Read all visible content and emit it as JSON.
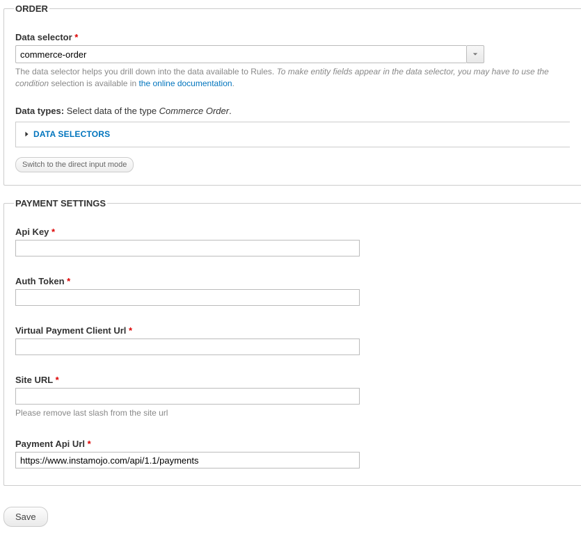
{
  "order_panel": {
    "legend": "ORDER",
    "data_selector_label": "Data selector",
    "data_selector_value": "commerce-order",
    "help_prefix": "The data selector helps you drill down into the data available to Rules. ",
    "help_italic": "To make entity fields appear in the data selector, you may have to use the condition",
    "help_suffix_prefix": " selection is available in ",
    "help_link_text": "the online documentation",
    "help_suffix_end": ".",
    "data_types_label": "Data types:",
    "data_types_text_prefix": " Select data of the type ",
    "data_types_em": "Commerce Order",
    "data_types_text_suffix": ".",
    "selectors_toggle": "DATA SELECTORS",
    "switch_mode_label": "Switch to the direct input mode"
  },
  "payment_panel": {
    "legend": "PAYMENT SETTINGS",
    "api_key_label": "Api Key",
    "api_key_value": "",
    "auth_token_label": "Auth Token",
    "auth_token_value": "",
    "vpc_label": "Virtual Payment Client Url",
    "vpc_value": "",
    "site_url_label": "Site URL",
    "site_url_value": "",
    "site_url_help": "Please remove last slash from the site url",
    "payment_api_label": "Payment Api Url",
    "payment_api_value": "https://www.instamojo.com/api/1.1/payments"
  },
  "save_label": "Save"
}
